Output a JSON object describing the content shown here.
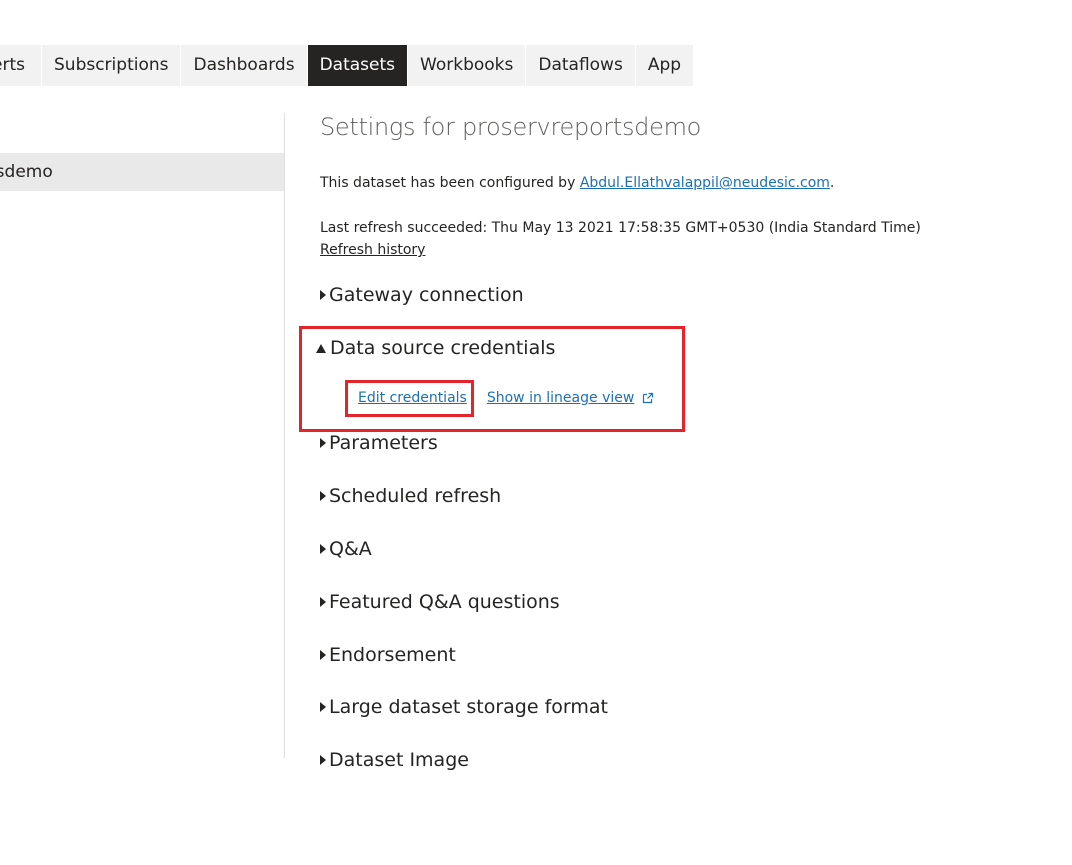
{
  "tabs": [
    {
      "label": "erts"
    },
    {
      "label": "Subscriptions"
    },
    {
      "label": "Dashboards"
    },
    {
      "label": "Datasets",
      "active": true
    },
    {
      "label": "Workbooks"
    },
    {
      "label": "Dataflows"
    },
    {
      "label": "App"
    }
  ],
  "left_pane": {
    "selected_item": "tsdemo"
  },
  "settings": {
    "title": "Settings for proservreportsdemo",
    "configured_prefix": "This dataset has been configured by ",
    "configured_by": "Abdul.Ellathvalappil@neudesic.com",
    "configured_suffix": ".",
    "last_refresh": "Last refresh succeeded: Thu May 13 2021 17:58:35 GMT+0530 (India Standard Time)",
    "refresh_history": "Refresh history"
  },
  "sections": {
    "gateway": "Gateway connection",
    "credentials": "Data source credentials",
    "edit_credentials": "Edit credentials",
    "lineage_view": "Show in lineage view",
    "parameters": "Parameters",
    "scheduled_refresh": "Scheduled refresh",
    "qna": "Q&A",
    "featured_qna": "Featured Q&A questions",
    "endorsement": "Endorsement",
    "large_dataset": "Large dataset storage format",
    "dataset_image": "Dataset Image"
  },
  "colors": {
    "active_tab_bg": "#252423",
    "tab_bg": "#f2f2f2",
    "link": "#1b70b5",
    "highlight": "#e3242b"
  }
}
